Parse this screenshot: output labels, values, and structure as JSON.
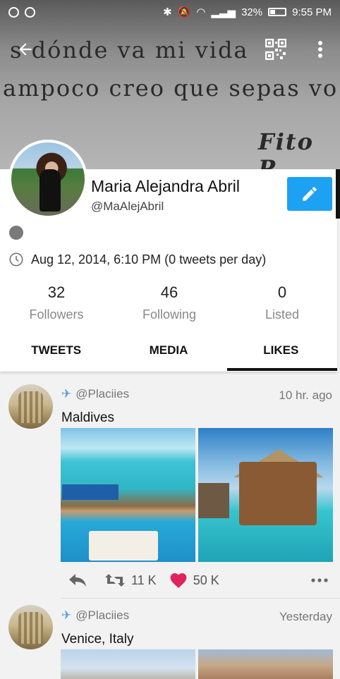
{
  "status_bar": {
    "battery": "32%",
    "time": "9:55 PM"
  },
  "banner": {
    "line1": "s dónde va mi vida",
    "line2": "ampoco creo que sepas vo",
    "line3": "Fito P"
  },
  "profile": {
    "name": "Maria Alejandra Abril",
    "handle": "@MaAlejAbril",
    "joined": "Aug 12, 2014, 6:10 PM (0 tweets per day)",
    "stats": [
      {
        "value": "32",
        "label": "Followers"
      },
      {
        "value": "46",
        "label": "Following"
      },
      {
        "value": "0",
        "label": "Listed"
      }
    ],
    "tabs": [
      {
        "label": "TWEETS"
      },
      {
        "label": "MEDIA"
      },
      {
        "label": "LIKES",
        "active": true
      }
    ]
  },
  "tweets": [
    {
      "handle": "@Placiies",
      "time": "10 hr. ago",
      "text": "Maldives",
      "retweets": "11 K",
      "likes": "50 K"
    },
    {
      "handle": "@Placiies",
      "time": "Yesterday",
      "text": "Venice, Italy"
    }
  ],
  "colors": {
    "accent": "#1da1f2",
    "like": "#e0245e"
  }
}
